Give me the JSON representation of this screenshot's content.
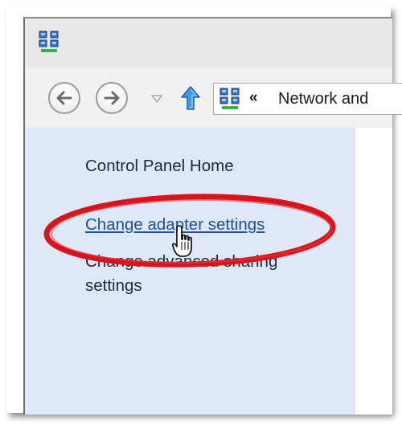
{
  "window": {
    "icon": "network-icon"
  },
  "navigation": {
    "back_icon": "back-arrow-icon",
    "forward_icon": "forward-arrow-icon",
    "recent_icon": "dropdown-triangle-icon",
    "up_icon": "up-arrow-icon"
  },
  "address_bar": {
    "icon": "network-icon",
    "chevrons": "«",
    "text": "Network and"
  },
  "sidebar": {
    "items": [
      {
        "label": "Control Panel Home"
      },
      {
        "label": "Change adapter settings"
      },
      {
        "label": "Change advanced sharing settings"
      }
    ]
  },
  "annotation": {
    "shape": "ellipse",
    "color": "#d8141c"
  },
  "cursor": {
    "type": "hand-pointer-icon"
  },
  "colors": {
    "sidebar_bg": "#dfe8f6",
    "link_blue": "#1f4f9e",
    "up_arrow": "#2f8ce0",
    "highlight_red": "#d8141c"
  }
}
